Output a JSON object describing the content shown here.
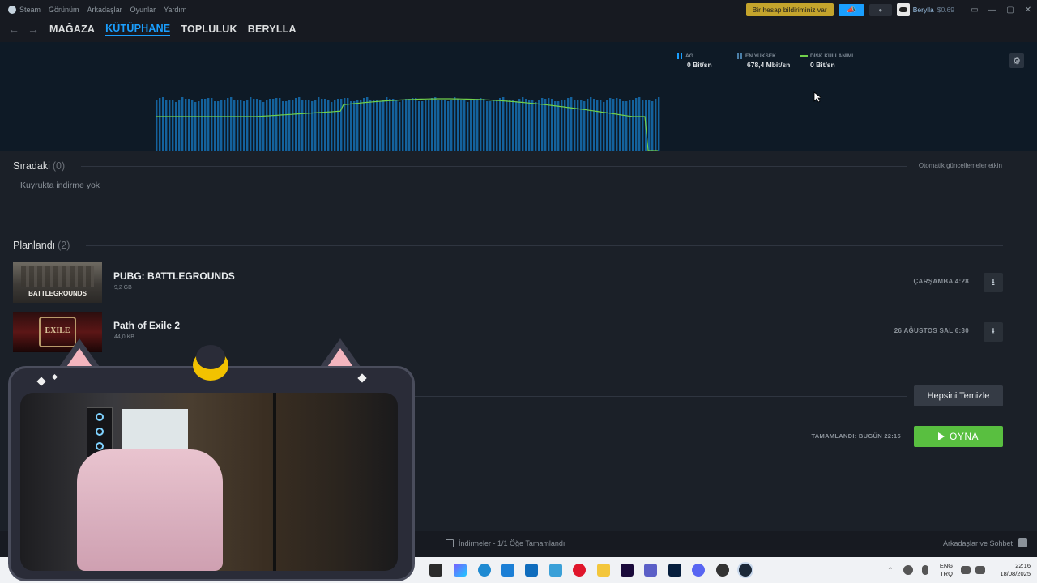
{
  "menubar": {
    "app": "Steam",
    "items": [
      "Görünüm",
      "Arkadaşlar",
      "Oyunlar",
      "Yardım"
    ],
    "account_warning": "Bir hesap bildiriminiz var",
    "username": "Berylla",
    "balance": "$0.69"
  },
  "nav": {
    "links": [
      "MAĞAZA",
      "KÜTÜPHANE",
      "TOPLULUK",
      "BERYLLA"
    ],
    "active": "KÜTÜPHANE"
  },
  "graph": {
    "stats": [
      {
        "label": "AĞ",
        "value": "0 Bit/sn"
      },
      {
        "label": "EN YÜKSEK",
        "value": "678,4 Mbit/sn"
      },
      {
        "label": "DİSK KULLANIMI",
        "value": "0 Bit/sn"
      }
    ],
    "colors": {
      "network": "#1a9fff",
      "disk": "#71d14b"
    }
  },
  "queue": {
    "title": "Sıradaki",
    "count": "(0)",
    "auto_updates": "Otomatik güncellemeler etkin",
    "empty": "Kuyrukta indirme yok"
  },
  "scheduled": {
    "title": "Planlandı",
    "count": "(2)",
    "games": [
      {
        "name": "PUBG: BATTLEGROUNDS",
        "size": "9,2 GB",
        "when": "ÇARŞAMBA 4:28",
        "thumb_text": "BATTLEGROUNDS"
      },
      {
        "name": "Path of Exile 2",
        "size": "44,0 KB",
        "when": "26 AĞUSTOS SAL 6:30",
        "thumb_text": "EXILE"
      }
    ]
  },
  "completed": {
    "clear_all": "Hepsini Temizle",
    "done_note": "TAMAMLANDI: BUGÜN 22:15",
    "play": "OYNA"
  },
  "statusbar": {
    "downloads": "İndirmeler - 1/1 Öğe Tamamlandı",
    "friends": "Arkadaşlar ve Sohbet"
  },
  "taskbar": {
    "lang_top": "ENG",
    "lang_bottom": "TRQ",
    "time": "22:16",
    "date": "18/08/2025"
  }
}
